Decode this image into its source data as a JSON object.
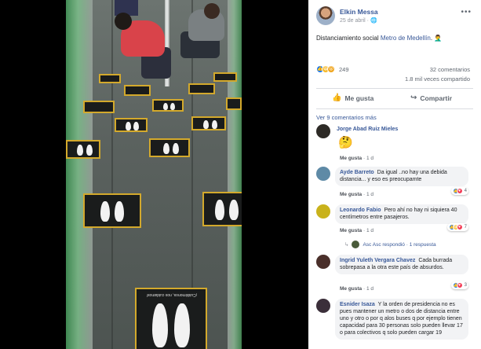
{
  "post": {
    "author": "Elkin Messa",
    "date": "25 de abril",
    "privacy_icon": "globe-icon",
    "text_before": "Distanciamiento social ",
    "text_link": "Metro de Medellín",
    "text_after": ". 🤦‍♂️",
    "reaction_count": "249",
    "comments_count": "32 comentarios",
    "shares": "1.8 mil veces compartido",
    "like_label": "Me gusta",
    "share_label": "Compartir",
    "more_comments": "Ver 9 comentarios más",
    "reactions_icons": [
      "like-icon",
      "haha-icon",
      "wow-icon"
    ]
  },
  "photo": {
    "sticker_text": "¡Cuidémonos, nos cuidamos!"
  },
  "comments": [
    {
      "name": "Jorge Abad Ruiz Mieles",
      "text": "🤔",
      "like": "Me gusta",
      "time": "1 d",
      "avatar_color": "#2d2a26"
    },
    {
      "name": "Ayde Barreto",
      "text": "Da igual ..no hay una debida distancia... y eso es preocupamte",
      "like": "Me gusta",
      "time": "1 d",
      "reactions": "4",
      "avatar_color": "#5e8aa6"
    },
    {
      "name": "Leonardo Fabio",
      "text": "Pero ahí no hay ni siquiera 40 centímetros entre pasajeros.",
      "like": "Me gusta",
      "time": "1 d",
      "reactions": "7",
      "avatar_color": "#c9b21b",
      "reply_author": "Asc Asc",
      "reply_text": "Asc Asc respondió · 1 respuesta"
    },
    {
      "name": "Ingrid Yuleth Vergara Chavez",
      "text": "Cada burrada sobrepasa a la otra este país de absurdos.",
      "like": "Me gusta",
      "time": "1 d",
      "reactions": "3",
      "avatar_color": "#4a2f2a"
    },
    {
      "name": "Esnider Isaza",
      "text": "Y la orden de presidencia no es pues mantener un metro o dos de distancia entre uno y otro o por q alos buses q por ejemplo tienen capacidad para 30 personas solo pueden llevar 17 o para colectivos q solo pueden cargar 19",
      "avatar_color": "#3b2f3a"
    }
  ],
  "colors": {
    "link": "#385898",
    "sticker_border": "#d3a92c",
    "like_blue": "#1877f2"
  }
}
